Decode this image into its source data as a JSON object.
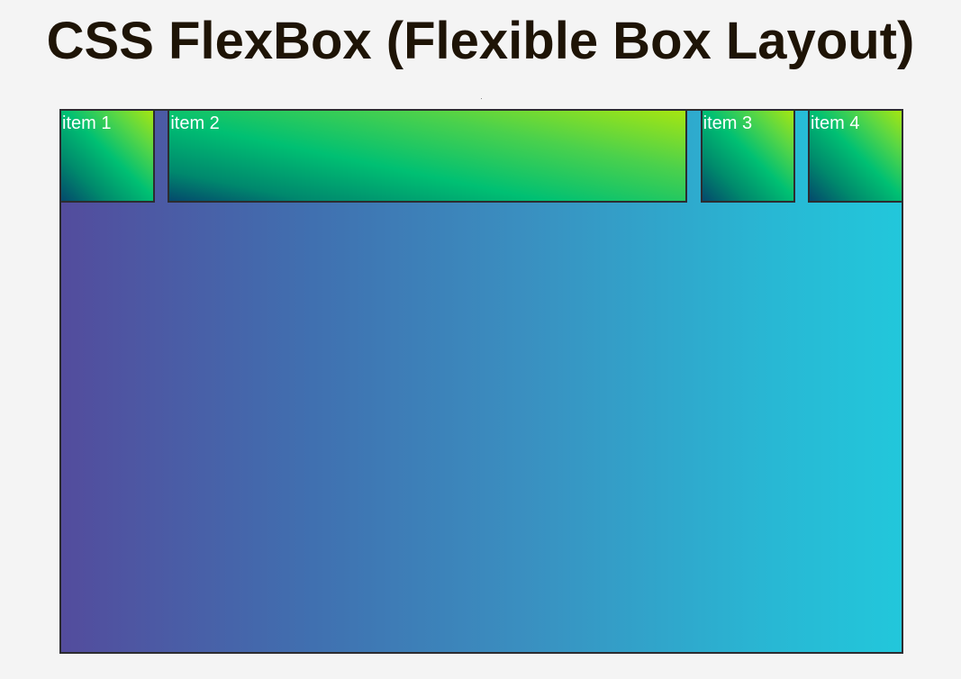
{
  "page": {
    "title": "CSS FlexBox (Flexible Box Layout)"
  },
  "flex_container": {
    "items": [
      {
        "label": "item 1"
      },
      {
        "label": "item 2"
      },
      {
        "label": "item 3"
      },
      {
        "label": "item 4"
      }
    ]
  },
  "colors": {
    "page_background": "#f4f4f4",
    "title_text": "#1e1406",
    "border": "#2c2c30",
    "container_gradient_start": "#534c9d",
    "container_gradient_end": "#22c7db",
    "item_gradient_start": "#04496c",
    "item_gradient_mid": "#00c073",
    "item_gradient_end": "#a6e611",
    "item_text": "#ffffff"
  }
}
